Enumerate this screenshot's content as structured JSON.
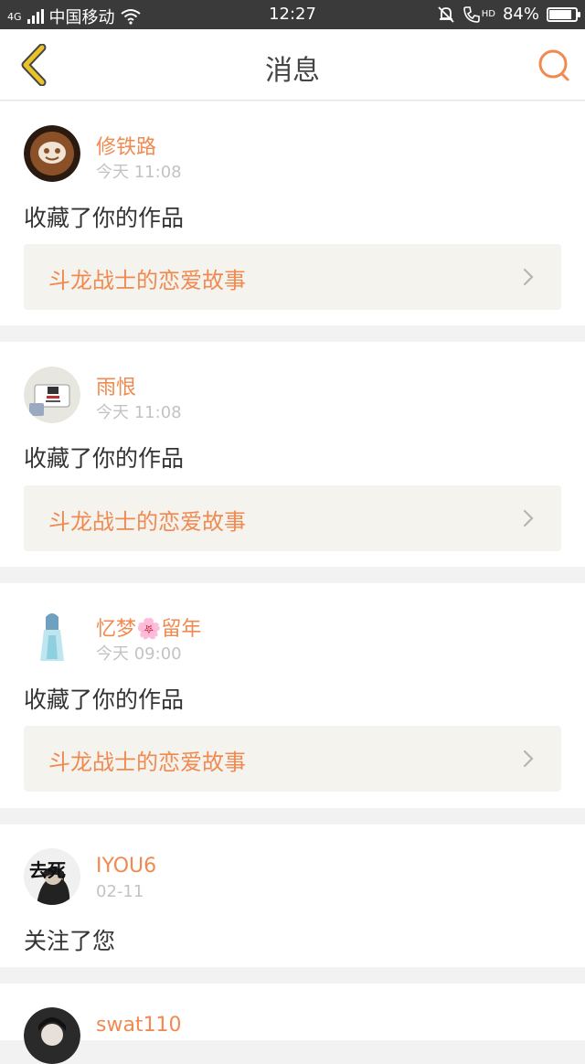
{
  "status_bar": {
    "signal_tag": "4G",
    "carrier": "中国移动",
    "time": "12:27",
    "hd": "HD",
    "battery_pct": "84%",
    "battery_level": 0.84
  },
  "navbar": {
    "title": "消息"
  },
  "colors": {
    "accent": "#f08a50",
    "back_icon": "#e8c32a",
    "card_bg": "#ffffff",
    "work_bg": "#f4f3ee"
  },
  "messages": [
    {
      "user": "修铁路",
      "time": "今天 11:08",
      "action": "收藏了你的作品",
      "work": "斗龙战士的恋爱故事"
    },
    {
      "user": "雨恨",
      "time": "今天 11:08",
      "action": "收藏了你的作品",
      "work": "斗龙战士的恋爱故事"
    },
    {
      "user": "忆梦🌸留年",
      "time": "今天 09:00",
      "action": "收藏了你的作品",
      "work": "斗龙战士的恋爱故事"
    },
    {
      "user": "IYOU6",
      "time": "02-11",
      "action": "关注了您",
      "avatar_text": "去死"
    },
    {
      "user": "swat110"
    }
  ]
}
